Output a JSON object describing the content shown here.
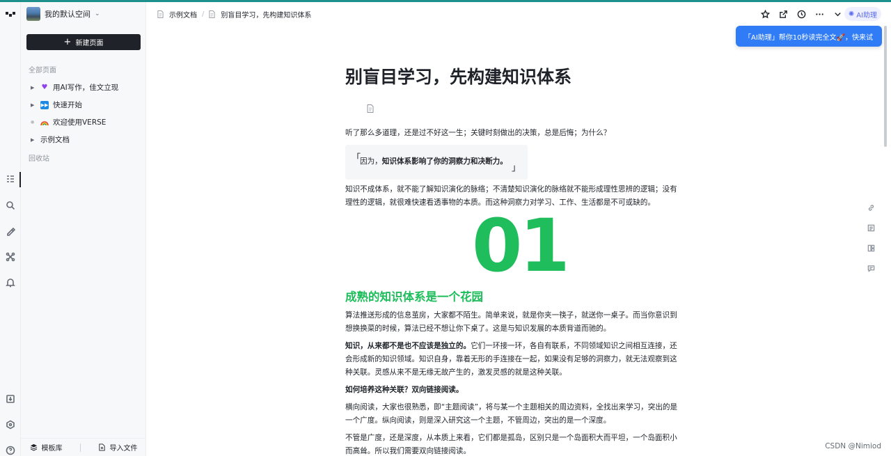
{
  "workspace": {
    "name": "我的默认空间"
  },
  "sidebar": {
    "new_page": "新建页面",
    "all_pages": "全部页面",
    "items": [
      {
        "icon": "purple-heart-icon",
        "label": "用AI写作，佳文立现"
      },
      {
        "icon": "fast-forward-icon",
        "label": "快速开始"
      },
      {
        "icon": "rainbow-icon",
        "label": "欢迎使用VERSE"
      },
      {
        "icon": "document-icon",
        "label": "示例文档"
      }
    ],
    "trash": "回收站",
    "template_library": "模板库",
    "import_file": "导入文件"
  },
  "breadcrumbs": [
    "示例文档",
    "别盲目学习，先构建知识体系"
  ],
  "header": {
    "ai_button": "AI助理"
  },
  "tooltip": "「AI助理」帮你10秒读完全文🚀，快来试",
  "doc": {
    "title": "别盲目学习，先构建知识体系",
    "p1": "听了那么多道理，还是过不好这一生；关键时刻做出的决策，总是后悔；为什么？",
    "quote_prefix": "因为，",
    "quote_bold": "知识体系影响了你的洞察力和决断力。",
    "p2": "知识不成体系，就不能了解知识演化的脉络；不清楚知识演化的脉络就不能形成理性思辨的逻辑；没有理性的逻辑，就很难快速看透事物的本质。而这种洞察力对学习、工作、生活都是不可或缺的。",
    "big_number": "01",
    "section_heading": "成熟的知识体系是一个花园",
    "p3": "算法推送形成的信息茧房，大家都不陌生。简单来说，就是你夹一筷子，就送你一桌子。而当你意识到想换换菜的时候，算法已经不想让你下桌了。这是与知识发展的本质背道而驰的。",
    "p4_bold": "知识，从来都不是也不应该是独立的。",
    "p4_rest": "它们一环接一环，各自有联系，不同领域知识之间相互连接，还会形成新的知识领域。知识自身，靠着无形的手连接在一起，如果没有足够的洞察力，就无法观察到这种关联。灵感从来不是无缘无故产生的，激发灵感的就是这种关联。",
    "p5_bold": "如何培养这种关联？双向链接阅读。",
    "p6": "横向阅读，大家也很熟悉，即“主题阅读”，将与某一个主题相关的周边资料，全找出来学习，突出的是一个广度。纵向阅读，则是深入研究这一个主题，不管周边，突出的是一个深度。",
    "p7": "不管是广度，还是深度，从本质上来看，它们都是孤岛，区别只是一个岛面积大而平坦，一个岛面积小而高耸。所以我们需要双向链接阅读。"
  },
  "watermark": "CSDN @Nimiod",
  "colors": {
    "accent_green": "#1fbd5b",
    "tooltip_blue": "#2f7cf6",
    "ai_purple": "#5b6cf0",
    "top_strip": "#1d8f8c"
  }
}
